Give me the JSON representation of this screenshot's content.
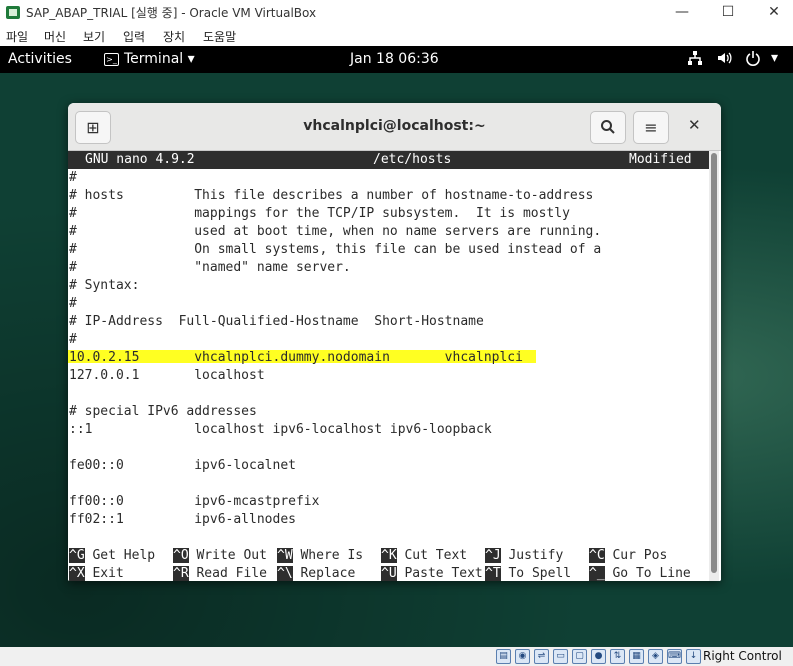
{
  "window": {
    "title": "SAP_ABAP_TRIAL [실행 중] - Oracle VM VirtualBox",
    "minimize": "—",
    "maximize": "☐",
    "close": "✕"
  },
  "menubar": {
    "items": [
      "파일",
      "머신",
      "보기",
      "입력",
      "장치",
      "도움말"
    ]
  },
  "gnome": {
    "activities": "Activities",
    "app_name": "Terminal",
    "app_arrow": "▾",
    "clock": "Jan 18  06:36",
    "icons": [
      "network-icon",
      "volume-icon",
      "power-icon",
      "chevron-down-icon"
    ]
  },
  "terminal": {
    "title": "vhcalnplci@localhost:~",
    "new_tab_glyph": "⊞",
    "search_glyph": "🔍",
    "menu_glyph": "≡",
    "close_glyph": "✕"
  },
  "nano": {
    "version": "GNU nano 4.9.2",
    "filename": "/etc/hosts",
    "state": "Modified",
    "lines": [
      "#",
      "# hosts         This file describes a number of hostname-to-address",
      "#               mappings for the TCP/IP subsystem.  It is mostly",
      "#               used at boot time, when no name servers are running.",
      "#               On small systems, this file can be used instead of a",
      "#               \"named\" name server.",
      "# Syntax:",
      "#",
      "# IP-Address  Full-Qualified-Hostname  Short-Hostname",
      "#",
      "10.0.2.15       vhcalnplci.dummy.nodomain       vhcalnplci",
      "127.0.0.1       localhost",
      "",
      "# special IPv6 addresses",
      "::1             localhost ipv6-localhost ipv6-loopback",
      "",
      "fe00::0         ipv6-localnet",
      "",
      "ff00::0         ipv6-mcastprefix",
      "ff02::1         ipv6-allnodes"
    ],
    "highlighted_line_index": 10,
    "shortcuts_row1": [
      {
        "key": "^G",
        "label": "Get Help"
      },
      {
        "key": "^O",
        "label": "Write Out"
      },
      {
        "key": "^W",
        "label": "Where Is"
      },
      {
        "key": "^K",
        "label": "Cut Text"
      },
      {
        "key": "^J",
        "label": "Justify"
      },
      {
        "key": "^C",
        "label": "Cur Pos"
      }
    ],
    "shortcuts_row2": [
      {
        "key": "^X",
        "label": "Exit"
      },
      {
        "key": "^R",
        "label": "Read File"
      },
      {
        "key": "^\\",
        "label": "Replace"
      },
      {
        "key": "^U",
        "label": "Paste Text"
      },
      {
        "key": "^T",
        "label": "To Spell"
      },
      {
        "key": "^_",
        "label": "Go To Line"
      }
    ]
  },
  "statusbar": {
    "right_control": "Right Control",
    "icons": [
      "hdd-icon",
      "optical-icon",
      "usb-icon",
      "shared-folder-icon",
      "display-icon",
      "recording-icon",
      "network-adapter-icon",
      "cpu-icon",
      "mouse-integration-icon",
      "keyboard-icon"
    ]
  },
  "colors": {
    "highlight": "#ffff22",
    "desktop": "#0f4034",
    "nano_bar": "#2e2e2e"
  }
}
